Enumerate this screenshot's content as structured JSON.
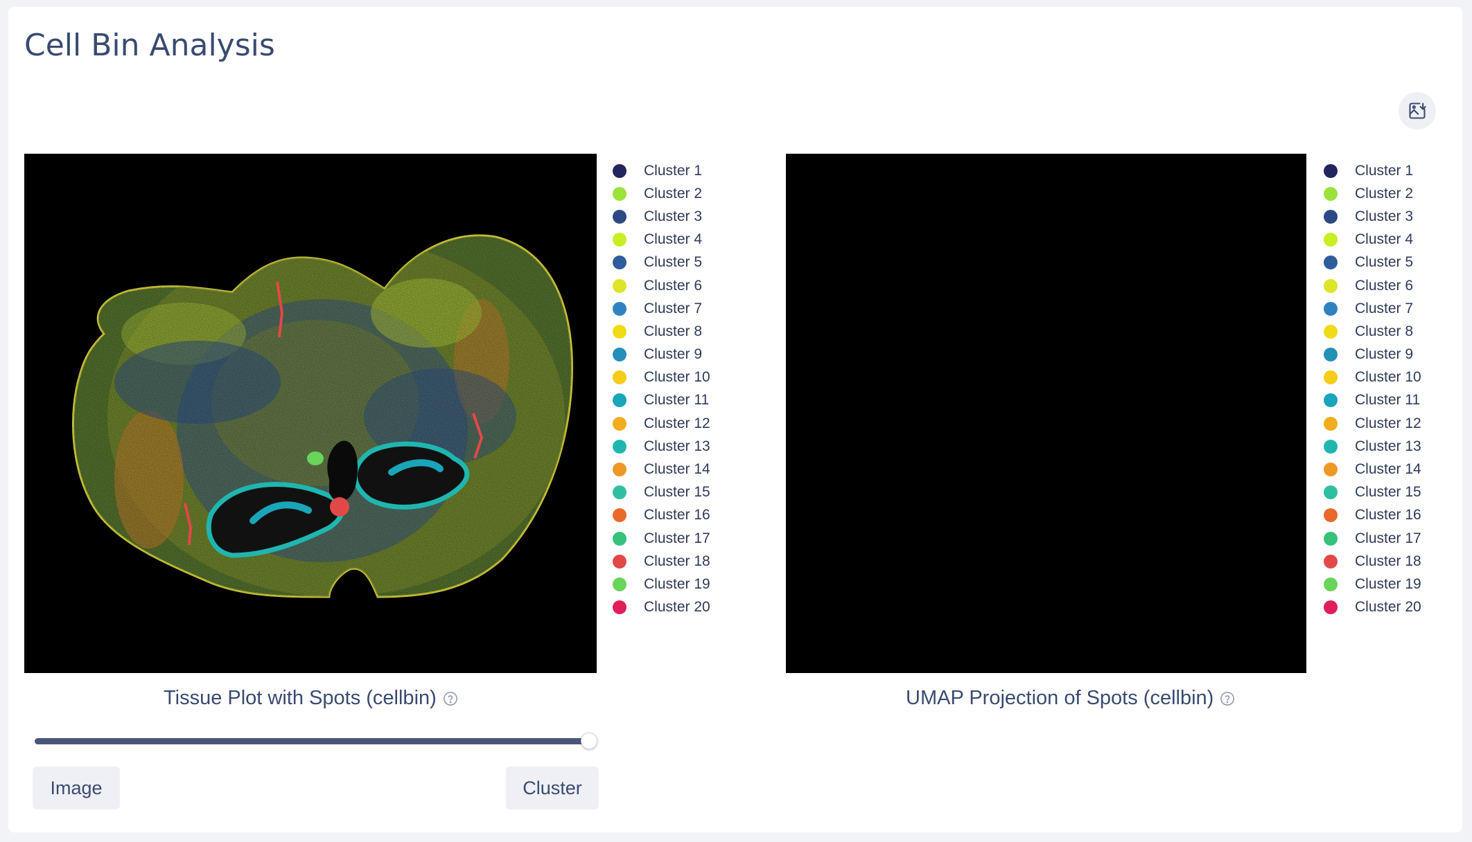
{
  "page": {
    "title": "Cell Bin Analysis"
  },
  "toolbar": {
    "export_icon": "image-download-icon"
  },
  "tissue_panel": {
    "caption": "Tissue Plot with Spots (cellbin)",
    "slider_value": 1.0,
    "left_button": "Image",
    "right_button": "Cluster"
  },
  "umap_panel": {
    "caption": "UMAP Projection of Spots (cellbin)"
  },
  "clusters": [
    {
      "label": "Cluster 1",
      "color": "#23255e"
    },
    {
      "label": "Cluster 2",
      "color": "#9be23a"
    },
    {
      "label": "Cluster 3",
      "color": "#2d4983"
    },
    {
      "label": "Cluster 4",
      "color": "#c8ee24"
    },
    {
      "label": "Cluster 5",
      "color": "#2f5d9c"
    },
    {
      "label": "Cluster 6",
      "color": "#dde528"
    },
    {
      "label": "Cluster 7",
      "color": "#2f82c0"
    },
    {
      "label": "Cluster 8",
      "color": "#f0dc16"
    },
    {
      "label": "Cluster 9",
      "color": "#258fb8"
    },
    {
      "label": "Cluster 10",
      "color": "#f5cc19"
    },
    {
      "label": "Cluster 11",
      "color": "#1aa5b8"
    },
    {
      "label": "Cluster 12",
      "color": "#f1ad1d"
    },
    {
      "label": "Cluster 13",
      "color": "#20b6b0"
    },
    {
      "label": "Cluster 14",
      "color": "#ee9826"
    },
    {
      "label": "Cluster 15",
      "color": "#2fbfa0"
    },
    {
      "label": "Cluster 16",
      "color": "#e9692a"
    },
    {
      "label": "Cluster 17",
      "color": "#36c27c"
    },
    {
      "label": "Cluster 18",
      "color": "#e24848"
    },
    {
      "label": "Cluster 19",
      "color": "#68d45a"
    },
    {
      "label": "Cluster 20",
      "color": "#e01e5a"
    }
  ]
}
